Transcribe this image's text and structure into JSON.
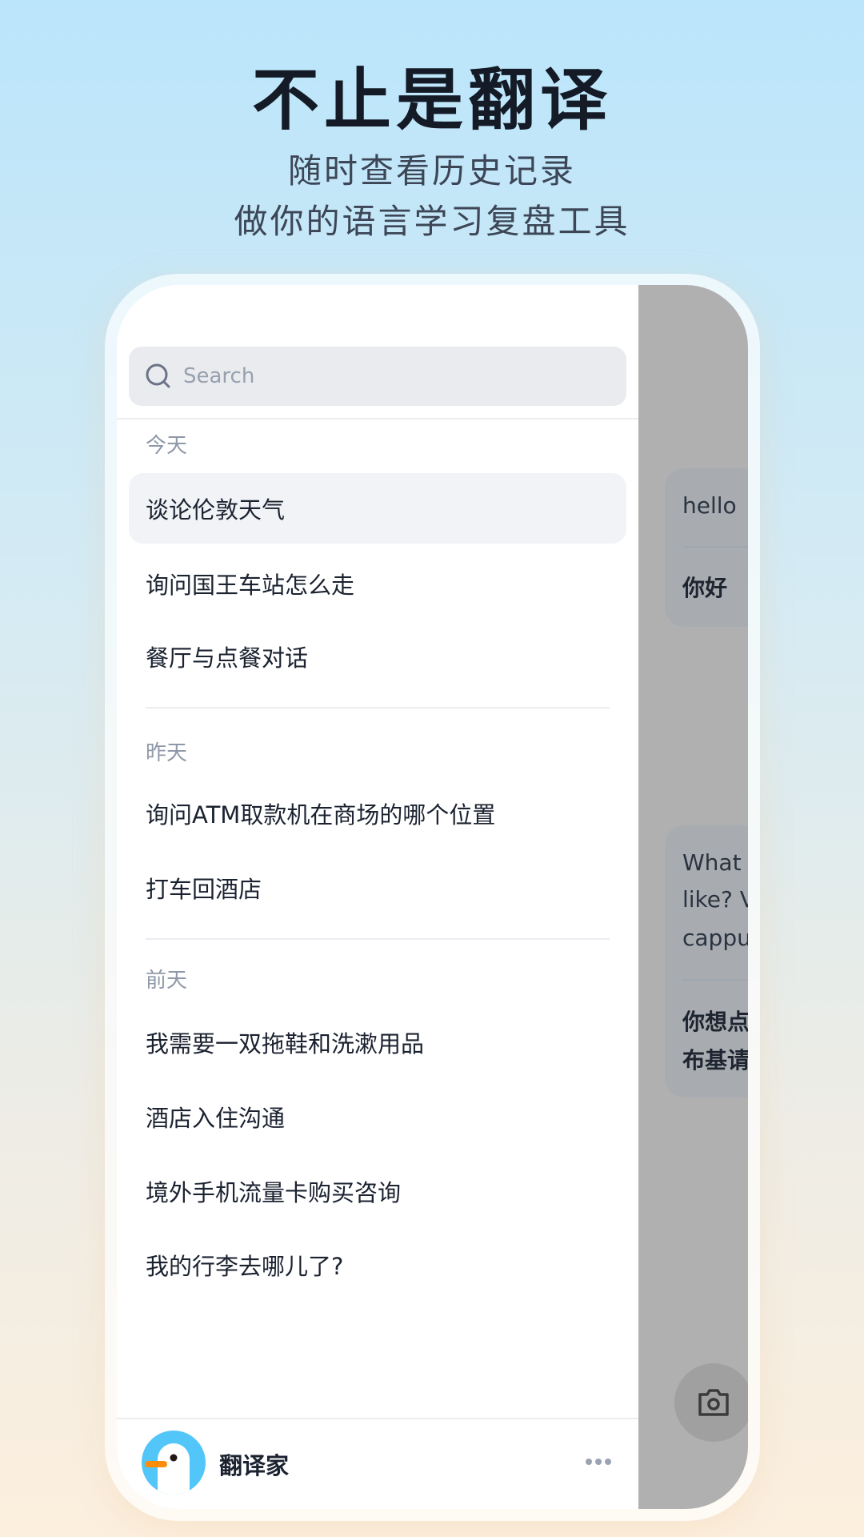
{
  "header": {
    "title": "不止是翻译",
    "subtitle_lines": [
      "随时查看历史记录",
      "做你的语言学习复盘工具"
    ]
  },
  "search": {
    "placeholder": "Search",
    "icon": "search-icon"
  },
  "sections": [
    {
      "label": "今天",
      "items": [
        "谈论伦敦天气",
        "询问国王车站怎么走",
        "餐厅与点餐对话"
      ]
    },
    {
      "label": "昨天",
      "items": [
        "询问ATM取款机在商场的哪个位置",
        "打车回酒店"
      ]
    },
    {
      "label": "前天",
      "items": [
        "我需要一双拖鞋和洗漱用品",
        "酒店入住沟通",
        "境外手机流量卡购买咨询",
        "我的行李去哪儿了?"
      ]
    }
  ],
  "footer": {
    "app_name": "翻译家",
    "more_icon": "more-icon"
  },
  "chat": {
    "card1": {
      "source": "hello",
      "target": "你好"
    },
    "card2": {
      "source_lines": [
        "What",
        "like? V",
        "cappu"
      ],
      "target_lines": [
        "你想点",
        "布基请"
      ]
    },
    "camera_icon": "camera-icon"
  },
  "colors": {
    "accent_avatar": "#52c6f8",
    "beak": "#ff8c0a",
    "overlay": "#b0b0b0"
  }
}
